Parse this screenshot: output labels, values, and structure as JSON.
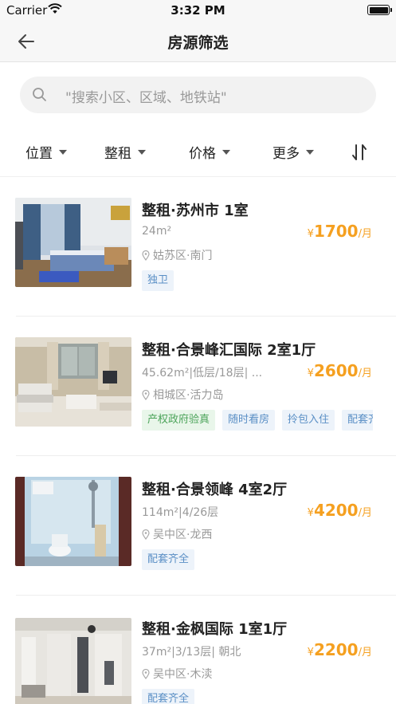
{
  "status_bar": {
    "carrier": "Carrier",
    "time": "3:32 PM"
  },
  "nav": {
    "title": "房源筛选"
  },
  "search": {
    "placeholder": "\"搜索小区、区域、地铁站\""
  },
  "filters": [
    {
      "label": "位置"
    },
    {
      "label": "整租"
    },
    {
      "label": "价格"
    },
    {
      "label": "更多"
    }
  ],
  "listings": [
    {
      "title": "整租·苏州市 1室",
      "meta": "24m²",
      "location": "姑苏区·南门",
      "price_currency": "¥",
      "price": "1700",
      "price_unit": "/月",
      "tags": [
        {
          "text": "独卫",
          "color": "blue"
        }
      ]
    },
    {
      "title": "整租·合景峰汇国际 2室1厅",
      "meta": "45.62m²|低层/18层| ...",
      "location": "相城区·活力岛",
      "price_currency": "¥",
      "price": "2600",
      "price_unit": "/月",
      "tags": [
        {
          "text": "产权政府验真",
          "color": "green"
        },
        {
          "text": "随时看房",
          "color": "blue"
        },
        {
          "text": "拎包入住",
          "color": "blue"
        },
        {
          "text": "配套齐全",
          "color": "blue"
        }
      ]
    },
    {
      "title": "整租·合景领峰 4室2厅",
      "meta": "114m²|4/26层",
      "location": "吴中区·龙西",
      "price_currency": "¥",
      "price": "4200",
      "price_unit": "/月",
      "tags": [
        {
          "text": "配套齐全",
          "color": "blue"
        }
      ]
    },
    {
      "title": "整租·金枫国际 1室1厅",
      "meta": "37m²|3/13层| 朝北",
      "location": "吴中区·木渎",
      "price_currency": "¥",
      "price": "2200",
      "price_unit": "/月",
      "tags": [
        {
          "text": "配套齐全",
          "color": "blue"
        }
      ]
    }
  ],
  "colors": {
    "price": "#f5a020",
    "tag_blue": "#5a8fc5",
    "tag_green": "#4ca45a"
  }
}
